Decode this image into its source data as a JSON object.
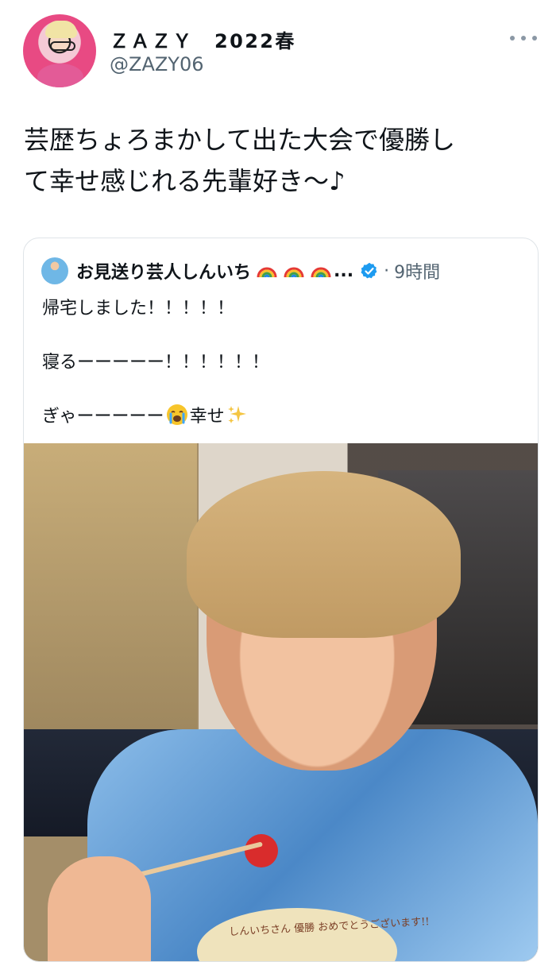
{
  "header": {
    "display_name": "ＺＡＺＹ　2022春",
    "handle": "@ZAZY06",
    "more_icon": "more-horizontal-icon"
  },
  "tweet": {
    "text_line1": "芸歴ちょろまかして出た大会で優勝し",
    "text_line2": "て幸せ感じれる先輩好き〜♪"
  },
  "quote": {
    "author_name": "お見送り芸人しんいち",
    "author_emoji": [
      "rainbow-icon",
      "rainbow-icon",
      "rainbow-icon"
    ],
    "ellipsis": "...",
    "verified_icon": "verified-badge-icon",
    "time_separator": "·",
    "time": "9時間",
    "lines": [
      "帰宅しました！！！！！",
      "寝るーーーーー！！！！！！",
      "ぎゃーーーーー",
      "幸せ"
    ],
    "photo_caption_writing": "しんいちさん 優勝 おめでとうございます!!"
  },
  "colors": {
    "text_primary": "#0f1419",
    "text_secondary": "#536471",
    "border": "#dfe4e8",
    "verified_blue": "#1d9bf0"
  }
}
